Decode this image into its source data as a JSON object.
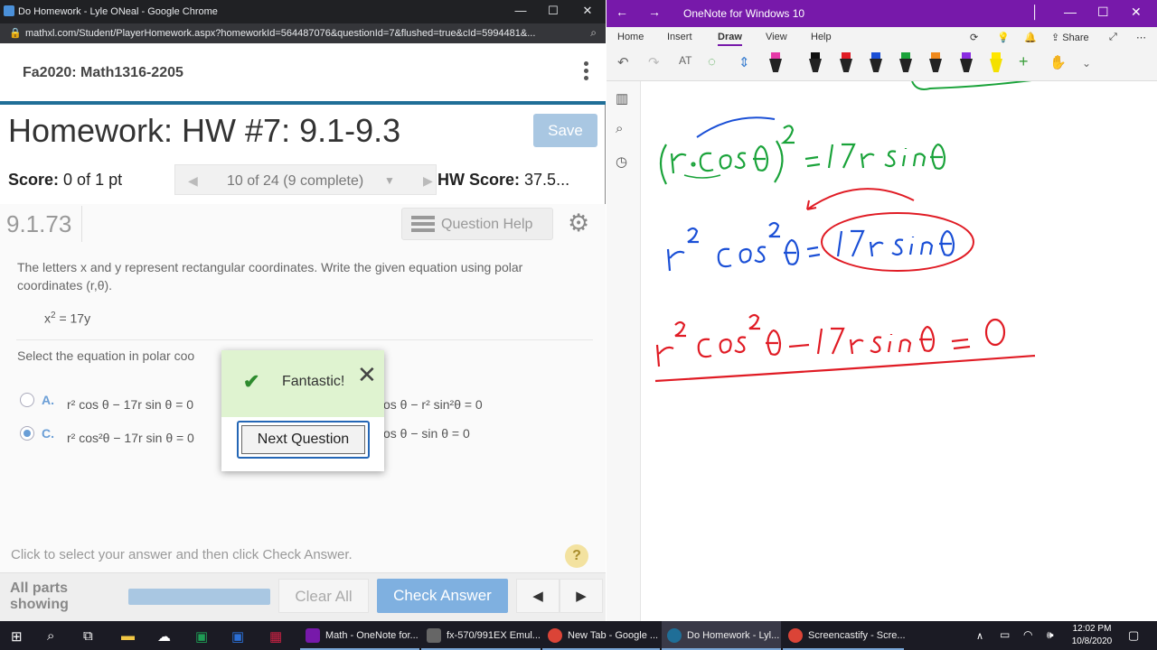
{
  "chrome": {
    "title": "Do Homework - Lyle ONeal - Google Chrome",
    "url": "mathxl.com/Student/PlayerHomework.aspx?homeworkId=564487076&questionId=7&flushed=true&cId=5994481&..."
  },
  "course": {
    "title": "Fa2020: Math1316-2205"
  },
  "homework": {
    "title": "Homework: HW #7: 9.1-9.3",
    "save_label": "Save",
    "score_label": "Score:",
    "score_value": "0 of 1 pt",
    "question_nav": "10 of 24 (9 complete)",
    "hw_score_label": "HW Score:",
    "hw_score_value": "37.5..."
  },
  "question": {
    "number": "9.1.73",
    "help_label": "Question Help",
    "text": "The letters x and y represent rectangular coordinates. Write the given equation using polar coordinates (r,θ).",
    "equation_base": "x",
    "equation_exp": "2",
    "equation_rest": " = 17y",
    "select_prompt": "Select the equation in polar coo",
    "options": {
      "A": {
        "letter": "A.",
        "text": "r² cos θ − 17r sin θ = 0"
      },
      "B": {
        "text": "os θ − r² sin²θ = 0"
      },
      "C": {
        "letter": "C.",
        "text": "r² cos²θ − 17r sin θ = 0"
      },
      "D": {
        "text": "os θ −  sin θ = 0"
      }
    },
    "selected": "C"
  },
  "popup": {
    "message": "Fantastic!",
    "next_label": "Next Question",
    "close": "✕"
  },
  "footer": {
    "hint": "Click to select your answer and then click Check Answer.",
    "help": "?",
    "all_parts_1": "All parts",
    "all_parts_2": "showing",
    "clear_label": "Clear All",
    "check_label": "Check Answer"
  },
  "onenote": {
    "title": "OneNote for Windows 10",
    "tabs": [
      "Home",
      "Insert",
      "Draw",
      "View",
      "Help"
    ],
    "active_tab": "Draw",
    "share_label": "Share"
  },
  "taskbar": {
    "items": [
      "Math - OneNote for...",
      "fx-570/991EX Emul...",
      "New Tab - Google ...",
      "Do Homework - Lyl...",
      "Screencastify - Scre..."
    ],
    "time": "12:02 PM",
    "date": "10/8/2020"
  },
  "colors": {
    "accent_blue": "#1f6e97",
    "onenote_purple": "#7719aa",
    "success_green": "#dff3d0",
    "ink_green": "#1aa33a",
    "ink_blue": "#1a4fd6",
    "ink_red": "#e01b24"
  }
}
